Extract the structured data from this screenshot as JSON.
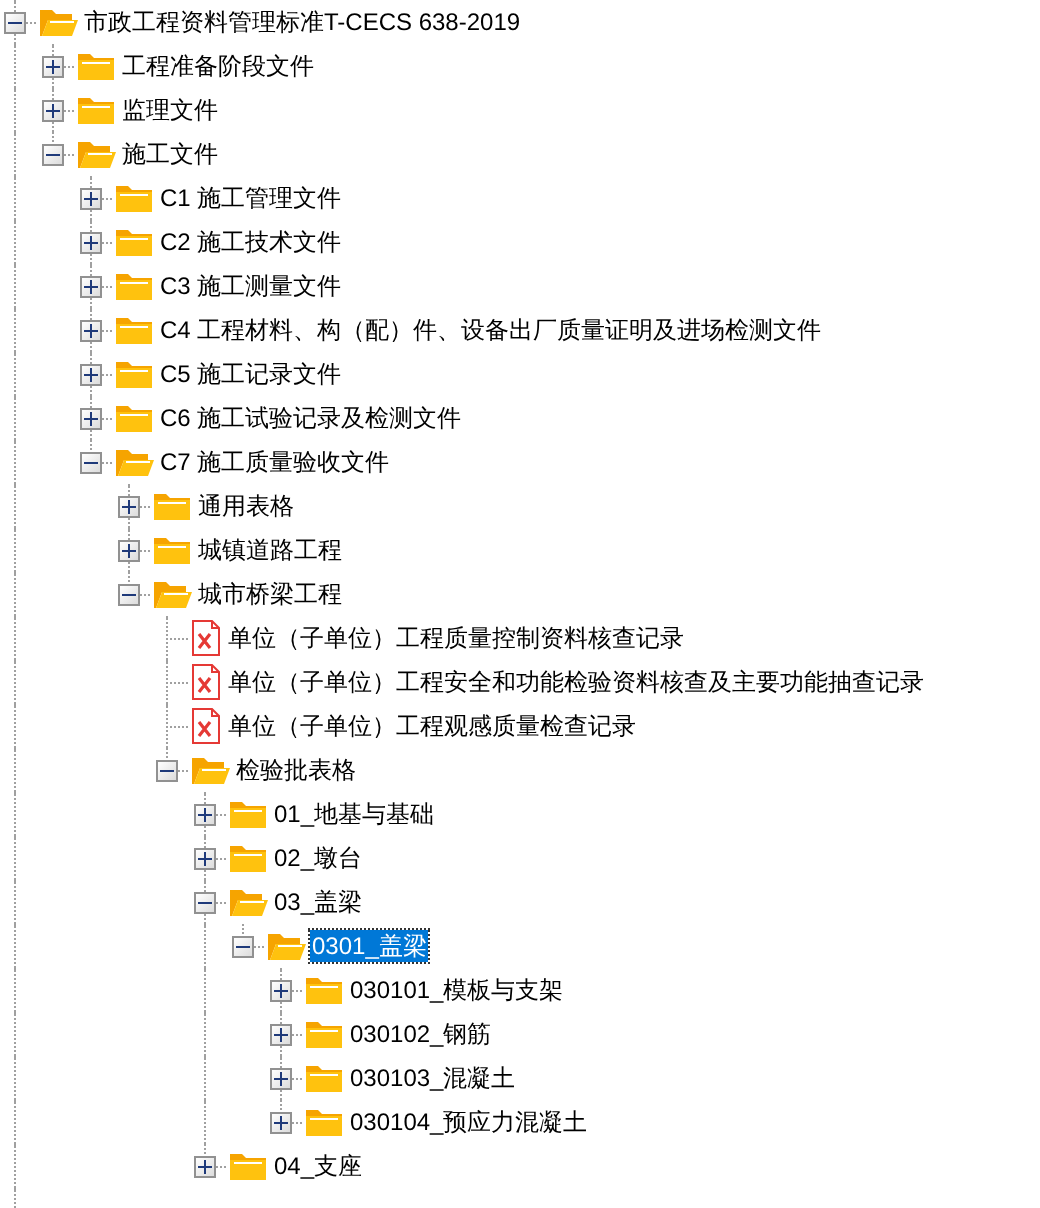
{
  "tree": [
    {
      "label": "市政工程资料管理标准T-CECS 638-2019",
      "kind": "folder",
      "expanded": true,
      "selected": false,
      "children": [
        {
          "label": "工程准备阶段文件",
          "kind": "folder",
          "expanded": false,
          "selected": false
        },
        {
          "label": "监理文件",
          "kind": "folder",
          "expanded": false,
          "selected": false
        },
        {
          "label": "施工文件",
          "kind": "folder",
          "expanded": true,
          "selected": false,
          "children": [
            {
              "label": "C1 施工管理文件",
              "kind": "folder",
              "expanded": false,
              "selected": false
            },
            {
              "label": "C2 施工技术文件",
              "kind": "folder",
              "expanded": false,
              "selected": false
            },
            {
              "label": "C3 施工测量文件",
              "kind": "folder",
              "expanded": false,
              "selected": false
            },
            {
              "label": "C4 工程材料、构（配）件、设备出厂质量证明及进场检测文件",
              "kind": "folder",
              "expanded": false,
              "selected": false
            },
            {
              "label": "C5 施工记录文件",
              "kind": "folder",
              "expanded": false,
              "selected": false
            },
            {
              "label": "C6 施工试验记录及检测文件",
              "kind": "folder",
              "expanded": false,
              "selected": false
            },
            {
              "label": "C7 施工质量验收文件",
              "kind": "folder",
              "expanded": true,
              "selected": false,
              "children": [
                {
                  "label": "通用表格",
                  "kind": "folder",
                  "expanded": false,
                  "selected": false
                },
                {
                  "label": "城镇道路工程",
                  "kind": "folder",
                  "expanded": false,
                  "selected": false
                },
                {
                  "label": "城市桥梁工程",
                  "kind": "folder",
                  "expanded": true,
                  "selected": false,
                  "children": [
                    {
                      "label": "单位（子单位）工程质量控制资料核查记录",
                      "kind": "file",
                      "selected": false
                    },
                    {
                      "label": "单位（子单位）工程安全和功能检验资料核查及主要功能抽查记录",
                      "kind": "file",
                      "selected": false
                    },
                    {
                      "label": "单位（子单位）工程观感质量检查记录",
                      "kind": "file",
                      "selected": false
                    },
                    {
                      "label": "检验批表格",
                      "kind": "folder",
                      "expanded": true,
                      "selected": false,
                      "children": [
                        {
                          "label": "01_地基与基础",
                          "kind": "folder",
                          "expanded": false,
                          "selected": false
                        },
                        {
                          "label": "02_墩台",
                          "kind": "folder",
                          "expanded": false,
                          "selected": false
                        },
                        {
                          "label": "03_盖梁",
                          "kind": "folder",
                          "expanded": true,
                          "selected": false,
                          "children": [
                            {
                              "label": "0301_盖梁",
                              "kind": "folder",
                              "expanded": true,
                              "selected": true,
                              "children": [
                                {
                                  "label": "030101_模板与支架",
                                  "kind": "folder",
                                  "expanded": false,
                                  "selected": false
                                },
                                {
                                  "label": "030102_钢筋",
                                  "kind": "folder",
                                  "expanded": false,
                                  "selected": false
                                },
                                {
                                  "label": "030103_混凝土",
                                  "kind": "folder",
                                  "expanded": false,
                                  "selected": false
                                },
                                {
                                  "label": "030104_预应力混凝土",
                                  "kind": "folder",
                                  "expanded": false,
                                  "selected": false
                                }
                              ]
                            }
                          ]
                        },
                        {
                          "label": "04_支座",
                          "kind": "folder",
                          "expanded": false,
                          "selected": false
                        }
                      ]
                    }
                  ]
                }
              ]
            }
          ]
        }
      ]
    }
  ]
}
